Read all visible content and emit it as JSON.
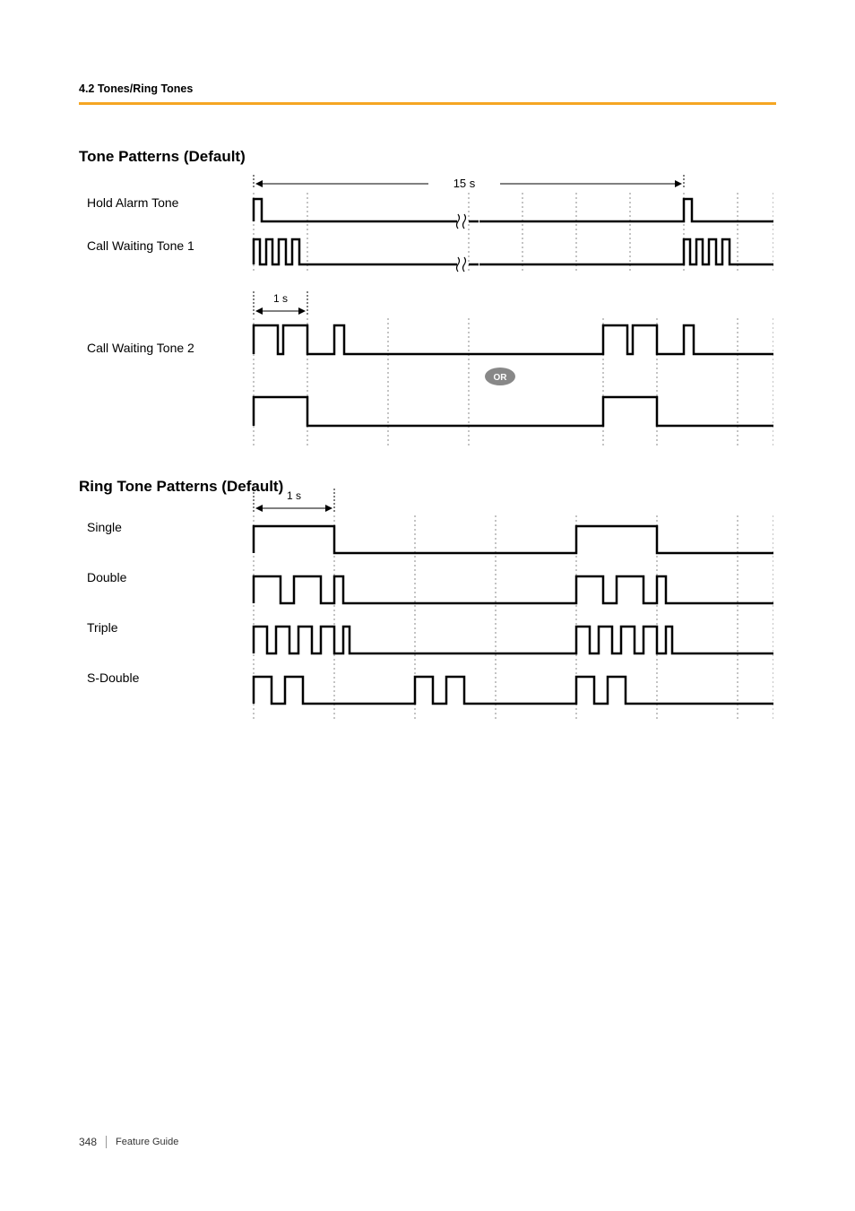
{
  "header": {
    "section_path": "4.2 Tones/Ring Tones"
  },
  "tone_section": {
    "title": "Tone Patterns (Default)",
    "duration_label_15s": "15 s",
    "duration_label_1s": "1 s",
    "rows": {
      "hold_alarm": "Hold Alarm Tone",
      "cw1": "Call Waiting Tone 1",
      "cw2": "Call Waiting Tone 2"
    },
    "or_label": "OR"
  },
  "ring_section": {
    "title": "Ring Tone Patterns  (Default)",
    "duration_label_1s": "1 s",
    "rows": {
      "single": "Single",
      "double": "Double",
      "triple": "Triple",
      "s_double": "S-Double"
    }
  },
  "footer": {
    "page_number": "348",
    "doc_title": "Feature Guide"
  }
}
